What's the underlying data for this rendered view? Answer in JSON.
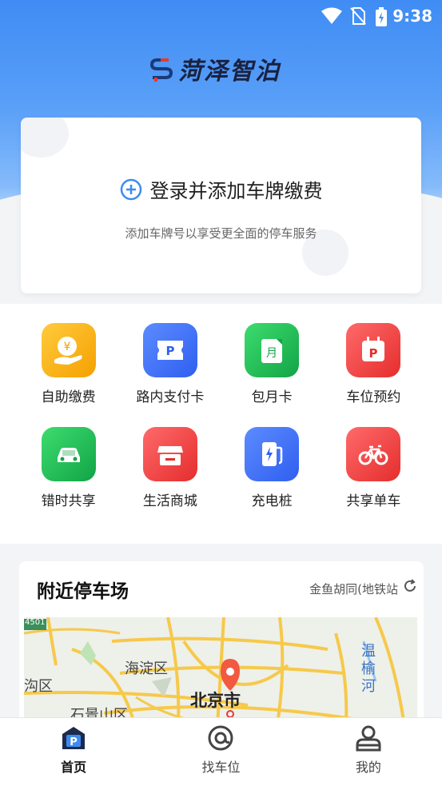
{
  "status_bar": {
    "time": "9:38"
  },
  "header": {
    "app_name": "菏泽智泊"
  },
  "login_card": {
    "title": "登录并添加车牌缴费",
    "subtitle": "添加车牌号以享受更全面的停车服务"
  },
  "services": [
    {
      "label": "自助缴费",
      "icon": "coin-hand-icon",
      "color": "#f5a623"
    },
    {
      "label": "路内支付卡",
      "icon": "parking-ticket-icon",
      "color": "#3b6ef0"
    },
    {
      "label": "包月卡",
      "icon": "monthly-card-icon",
      "color": "#1fb456"
    },
    {
      "label": "车位预约",
      "icon": "calendar-parking-icon",
      "color": "#ee3d3d"
    },
    {
      "label": "错时共享",
      "icon": "car-icon",
      "color": "#22b856"
    },
    {
      "label": "生活商城",
      "icon": "store-icon",
      "color": "#ee3d3d"
    },
    {
      "label": "充电桩",
      "icon": "charging-station-icon",
      "color": "#3b6ef0"
    },
    {
      "label": "共享单车",
      "icon": "bicycle-icon",
      "color": "#ee3d3d"
    }
  ],
  "nearby": {
    "title": "附近停车场",
    "location": "金鱼胡同(地铁站",
    "map_labels": {
      "road_shield": "4501",
      "haidian": "海淀区",
      "west": "沟区",
      "shijingshan": "石景山区",
      "city": "北京市",
      "river": [
        "温",
        "榆",
        "河"
      ]
    }
  },
  "tabs": [
    {
      "label": "首页",
      "icon": "home-parking-icon",
      "active": true
    },
    {
      "label": "找车位",
      "icon": "find-parking-icon",
      "active": false
    },
    {
      "label": "我的",
      "icon": "user-icon",
      "active": false
    }
  ]
}
